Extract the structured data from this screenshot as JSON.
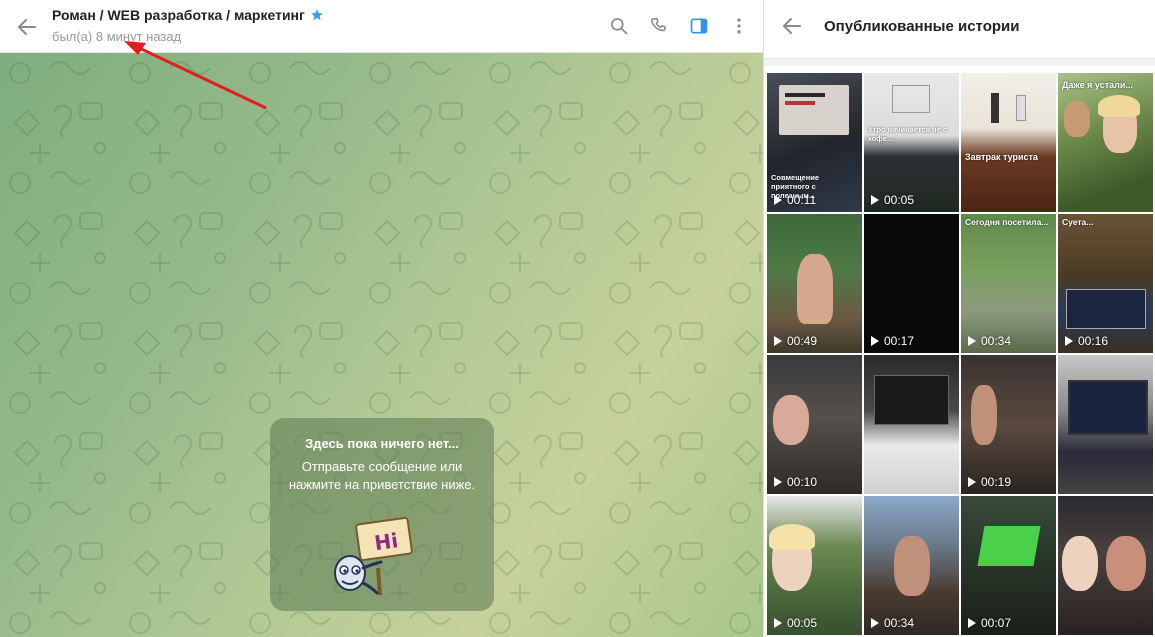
{
  "chat": {
    "title": "Роман / WEB разработка / маркетинг",
    "status": "был(а) 8 минут назад",
    "empty_title": "Здесь пока ничего нет...",
    "empty_text": "Отправьте сообщение или нажмите на приветствие ниже.",
    "sticker_text": "Hi"
  },
  "stories": {
    "title": "Опубликованные истории",
    "items": [
      {
        "duration": "00:11",
        "caption": "Совмещение приятного с полезным..."
      },
      {
        "duration": "00:05",
        "caption": "Утро начинается не с кофе..."
      },
      {
        "duration": "",
        "caption": "Завтрак туриста"
      },
      {
        "duration": "",
        "caption": "Даже я устали..."
      },
      {
        "duration": "00:49",
        "caption": ""
      },
      {
        "duration": "00:17",
        "caption": ""
      },
      {
        "duration": "00:34",
        "caption": "Сегодня посетила..."
      },
      {
        "duration": "00:16",
        "caption": "Суета..."
      },
      {
        "duration": "00:10",
        "caption": ""
      },
      {
        "duration": "",
        "caption": ""
      },
      {
        "duration": "00:19",
        "caption": ""
      },
      {
        "duration": "",
        "caption": ""
      },
      {
        "duration": "00:05",
        "caption": ""
      },
      {
        "duration": "00:34",
        "caption": ""
      },
      {
        "duration": "00:07",
        "caption": ""
      },
      {
        "duration": "",
        "caption": ""
      }
    ]
  },
  "colors": {
    "accent": "#3390ec",
    "star": "#3aa0e8",
    "arrow": "#e0201e"
  },
  "icons": [
    "back-arrow-icon",
    "star-icon",
    "search-icon",
    "phone-icon",
    "sidebar-toggle-icon",
    "more-vert-icon",
    "play-icon"
  ]
}
